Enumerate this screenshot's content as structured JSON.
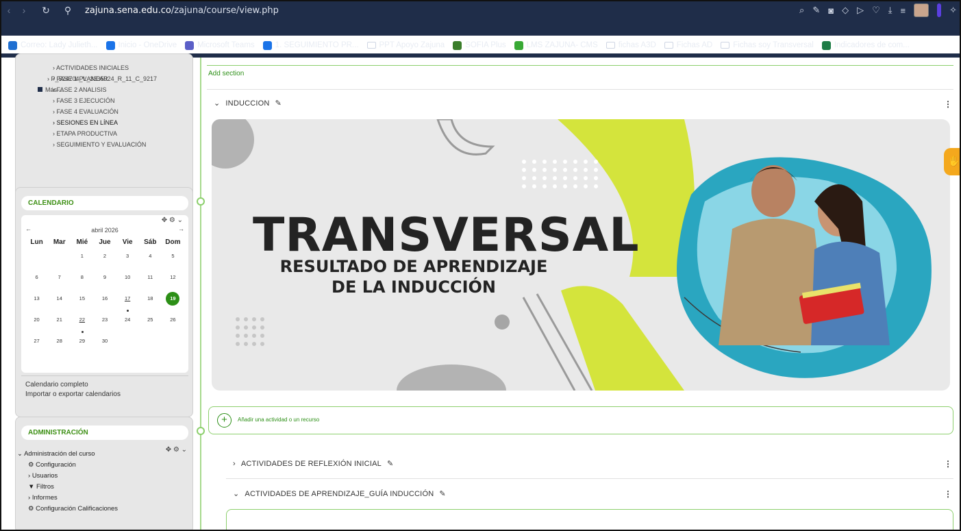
{
  "browser": {
    "url_host": "zajuna.sena.edu.co",
    "url_path": "/zajuna/course/view.php",
    "bookmarks": [
      {
        "label": "Correo: Lady Julieth...",
        "icon": "outlook-icon",
        "color": "#1f6fd1"
      },
      {
        "label": "Inicio - OneDrive",
        "icon": "onedrive-icon",
        "color": "#1a73e8"
      },
      {
        "label": "Microsoft Teams",
        "icon": "teams-icon",
        "color": "#5b5fc7"
      },
      {
        "label": "1. SEGUIMIENTO PR...",
        "icon": "onedrive-icon",
        "color": "#1a73e8"
      },
      {
        "label": "PPT Apoyo Zajuna",
        "icon": "folder-icon",
        "color": "#1f2d49"
      },
      {
        "label": "SOFIA Plus",
        "icon": "sofia-icon",
        "color": "#3a7d2a"
      },
      {
        "label": "LMS ZAJUNA- CMS",
        "icon": "sena-icon",
        "color": "#39a935"
      },
      {
        "label": "fichas A3D",
        "icon": "folder-icon",
        "color": "#1f2d49"
      },
      {
        "label": "Fichas AD",
        "icon": "folder-icon",
        "color": "#1f2d49"
      },
      {
        "label": "Fichas soy Transversal",
        "icon": "folder-icon",
        "color": "#1f2d49"
      },
      {
        "label": "Indicadores de com...",
        "icon": "excel-icon",
        "color": "#1d7b45"
      }
    ]
  },
  "nav_tree": {
    "items": [
      "ACTIVIDADES INICIALES",
      "FASE 1 PLANEAR",
      "FASE 2 ANALISIS",
      "FASE 3 EJECUCIÓN",
      "FASE 4 EVALUACIÓN",
      "SESIONES EN LÍNEA",
      "ETAPA PRODUCTIVA",
      "SEGUIMIENTO Y EVALUACIÓN"
    ],
    "course": "P_524704_V_3335924_R_11_C_9217",
    "more": "Más ..."
  },
  "calendar": {
    "title": "CALENDARIO",
    "month": "abril 2026",
    "weekdays": [
      "Lun",
      "Mar",
      "Mié",
      "Jue",
      "Vie",
      "Sáb",
      "Dom"
    ],
    "leading_blanks": 2,
    "days": 30,
    "today": 19,
    "event_days": [
      17,
      22
    ],
    "link_full": "Calendario completo",
    "link_export": "Importar o exportar calendarios"
  },
  "admin": {
    "title": "ADMINISTRACIÓN",
    "course_admin": "Administración del curso",
    "items": [
      "Configuración",
      "Usuarios",
      "Filtros",
      "Informes",
      "Configuración Calificaciones"
    ]
  },
  "main": {
    "add_section": "Add section",
    "section_induccion": "INDUCCION",
    "banner_title": "TRANSVERSAL",
    "banner_sub1": "RESULTADO DE APRENDIZAJE",
    "banner_sub2": "DE LA INDUCCIÓN",
    "add_activity": "Añadir una actividad o un recurso",
    "subsection_1": "ACTIVIDADES DE REFLEXIÓN INICIAL",
    "subsection_2": "ACTIVIDADES DE APRENDIZAJE_GUÍA INDUCCIÓN"
  },
  "colors": {
    "brand_green": "#2c8f16",
    "accent_lime": "#d4e43c",
    "chrome": "#1f2d49",
    "teal": "#2aa6c0"
  }
}
